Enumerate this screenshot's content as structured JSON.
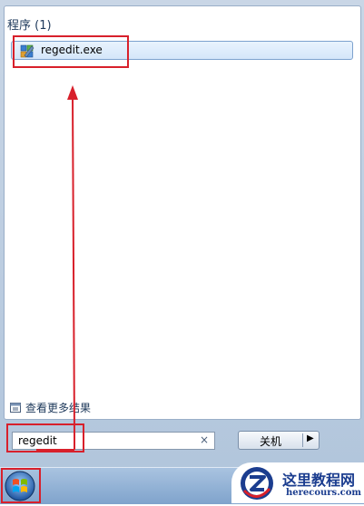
{
  "results": {
    "section_title": "程序 (1)",
    "items": [
      {
        "label": "regedit.exe",
        "icon": "registry-editor-icon"
      }
    ]
  },
  "see_more": {
    "label": "查看更多结果",
    "icon": "search-results-icon"
  },
  "search": {
    "value": "regedit",
    "clear_glyph": "×"
  },
  "shutdown": {
    "label": "关机",
    "arrow_glyph": "▶"
  },
  "watermark": {
    "title": "这里教程网",
    "url": "herecours.com"
  },
  "colors": {
    "highlight": "#d8202b",
    "accent": "#1e395b"
  }
}
